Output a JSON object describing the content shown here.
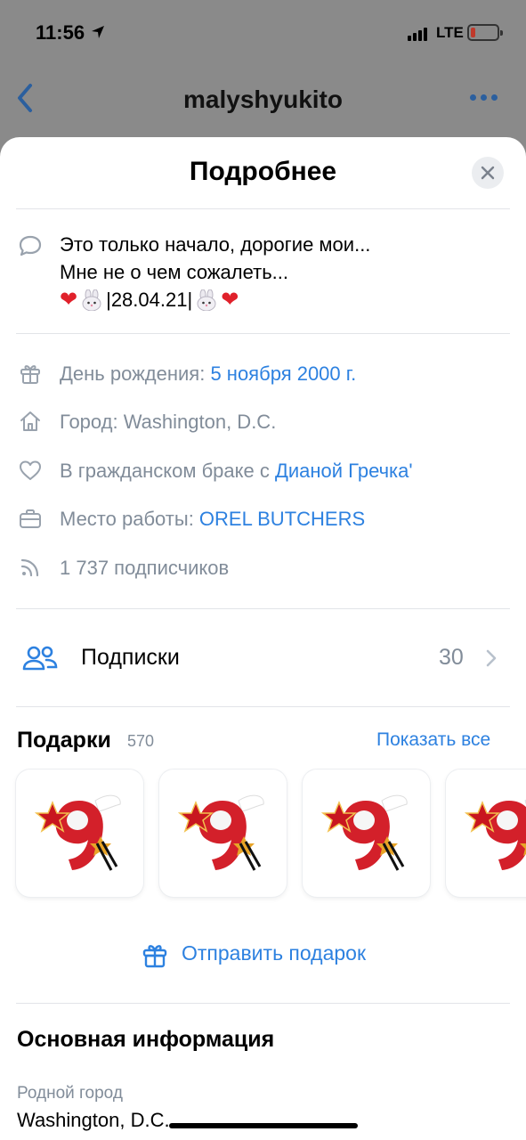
{
  "status_bar": {
    "time": "11:56",
    "network": "LTE"
  },
  "nav": {
    "title": "malyshyukito"
  },
  "sheet": {
    "title": "Подробнее"
  },
  "status": {
    "line1": "Это только начало, дорогие мои...",
    "line2": "Мне не о чем сожалеть...",
    "line3_date": "|28.04.21|"
  },
  "info": {
    "birthday_label": "День рождения: ",
    "birthday_value": "5 ноября 2000 г.",
    "city_label": "Город: Washington, D.C.",
    "relationship_label": "В гражданском браке с ",
    "relationship_value": "Дианой Гречка'",
    "work_label": "Место работы: ",
    "work_value": "OREL BUTCHERS",
    "followers": "1 737 подписчиков"
  },
  "subscriptions": {
    "label": "Подписки",
    "count": "30"
  },
  "gifts": {
    "title": "Подарки",
    "count": "570",
    "show_all": "Показать все",
    "send": "Отправить подарок"
  },
  "main_info": {
    "title": "Основная информация",
    "hometown_label": "Родной город",
    "hometown_value": "Washington, D.C."
  },
  "colors": {
    "accent": "#2d81e0",
    "secondary_text": "#818c99",
    "heart": "#e0212b",
    "gift_red": "#d3202a"
  },
  "icons": [
    "location-arrow-icon",
    "back-chevron-icon",
    "more-dots-icon",
    "close-icon",
    "speech-bubble-icon",
    "gift-icon",
    "home-icon",
    "heart-icon",
    "briefcase-icon",
    "rss-icon",
    "users-icon",
    "chevron-right-icon"
  ]
}
